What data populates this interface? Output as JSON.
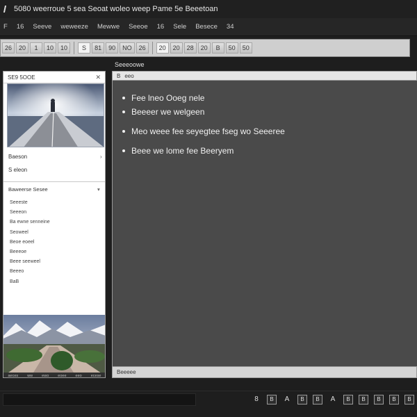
{
  "window": {
    "title": "5080 weerroue 5 sea Seoat woleo weep Pame 5e Beeetoan"
  },
  "menu": {
    "items": [
      "F",
      "16",
      "Seeve",
      "weweeze",
      "Mewwe",
      "Seeoe",
      "16",
      "Sele",
      "Besece",
      "34"
    ]
  },
  "toolbar": {
    "buttons": [
      "26",
      "20",
      "1",
      "10",
      "10",
      "S",
      "81",
      "90",
      "NO",
      "26",
      "20",
      "20",
      "28",
      "20",
      "B",
      "50",
      "50"
    ]
  },
  "left_panel": {
    "title": "SE9 5OOE",
    "row1": "Baeson",
    "row2": "S eleon",
    "section": "Baweerse Sesee",
    "list": [
      "Seeeste",
      "Seeeon",
      "Ba ewne senneine",
      "Seoweel",
      "Beoe eoeel",
      "Beeeoe",
      "Beee seeweel",
      "Beeeo",
      "BaB"
    ],
    "footer": [
      "aeces",
      "ww",
      "ewo",
      "eoee",
      "eeo",
      "ecese"
    ]
  },
  "main": {
    "title": "Seeeoowe",
    "tab_icon": "B",
    "tab_label": "eeo",
    "bullets": [
      "Fee lneo Ooeg nele",
      "Beeeer we welgeen",
      "Meo weee fee seyegtee fseg wo Seeeree",
      "Beee we lome fee Beeryem"
    ],
    "status": "Beeeee"
  },
  "bottom": {
    "icons": [
      "document-icon",
      "table-icon",
      "image-icon",
      "grid-icon",
      "box-icon",
      "text-icon",
      "table-icon",
      "grid-icon",
      "grid-icon",
      "table-icon",
      "grid-icon"
    ],
    "glyphs": [
      "8",
      "B",
      "A",
      "B",
      "B",
      "A",
      "B",
      "B",
      "B",
      "B",
      "B"
    ]
  }
}
